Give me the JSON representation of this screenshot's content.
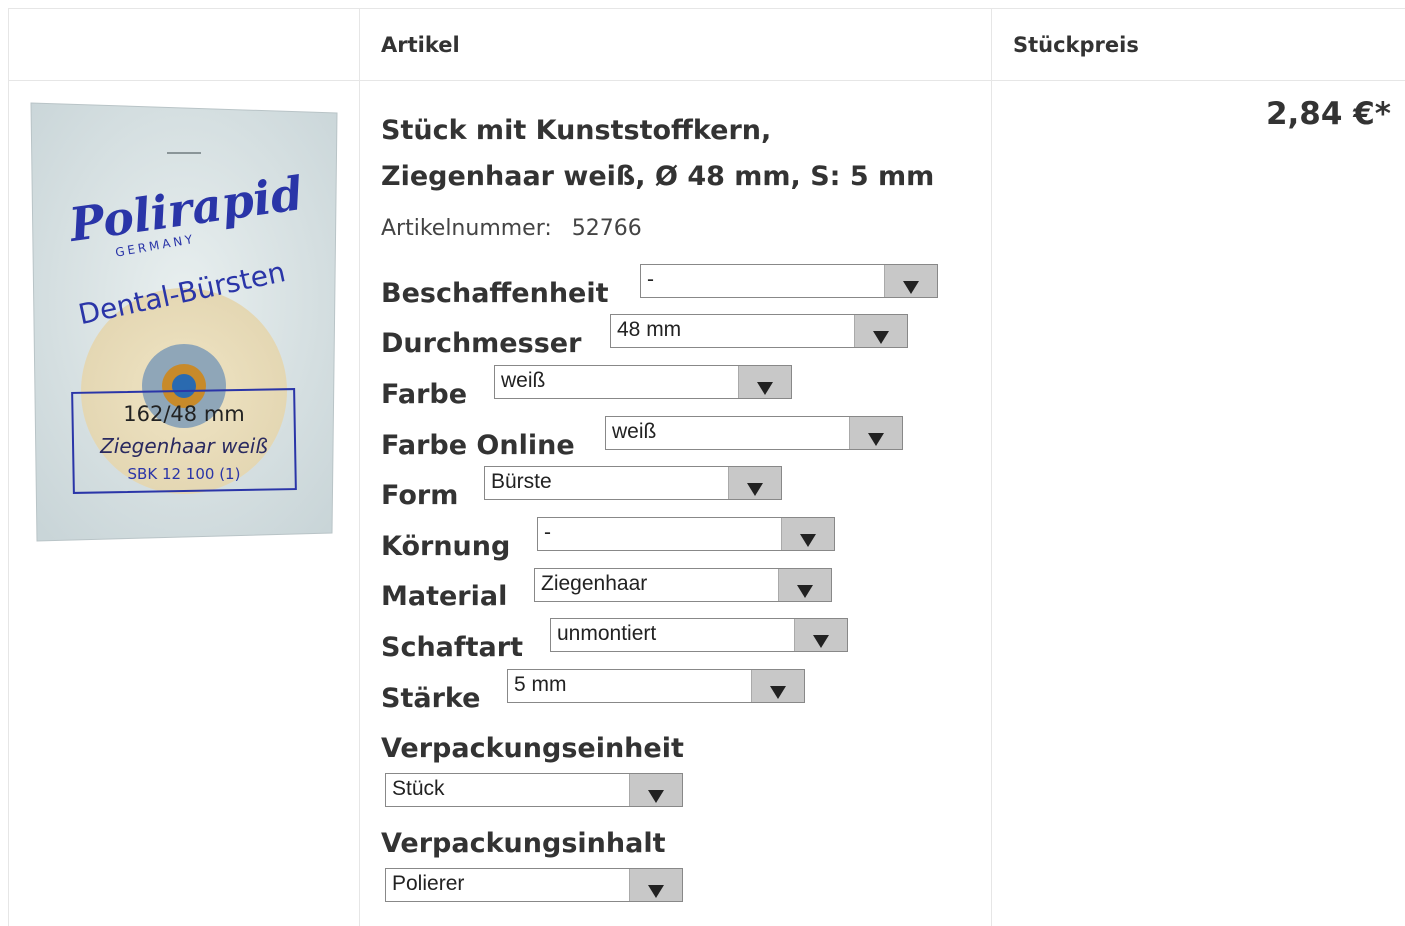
{
  "table": {
    "headers": {
      "article": "Artikel",
      "unit_price": "Stückpreis"
    }
  },
  "product": {
    "title_line1": "Stück mit Kunststoffkern,",
    "title_line2": "Ziegenhaar weiß, Ø 48 mm, S: 5 mm",
    "article_number_label": "Artikelnummer:",
    "article_number": "52766",
    "price": "2,84 €*",
    "image_text": {
      "brand": "Polirapid",
      "country": "GERMANY",
      "line": "Dental-Bürsten",
      "size": "162/48 mm",
      "material": "Ziegenhaar weiß",
      "code": "SBK 12 100 (1)"
    }
  },
  "properties": [
    {
      "label": "Beschaffenheit",
      "value": "-"
    },
    {
      "label": "Durchmesser",
      "value": "48 mm"
    },
    {
      "label": "Farbe",
      "value": "weiß"
    },
    {
      "label": "Farbe Online",
      "value": "weiß"
    },
    {
      "label": "Form",
      "value": "Bürste"
    },
    {
      "label": "Körnung",
      "value": "-"
    },
    {
      "label": "Material",
      "value": "Ziegenhaar"
    },
    {
      "label": "Schaftart",
      "value": "unmontiert"
    },
    {
      "label": "Stärke",
      "value": "5 mm"
    },
    {
      "label": "Verpackungseinheit",
      "value": "Stück"
    },
    {
      "label": "Verpackungsinhalt",
      "value": "Polierer"
    }
  ],
  "colors": {
    "brand_blue": "#2a35a8",
    "border": "#e6e6e6",
    "select_button": "#c8c8c8"
  },
  "icons": {
    "dropdown": "triangle-down-icon"
  }
}
